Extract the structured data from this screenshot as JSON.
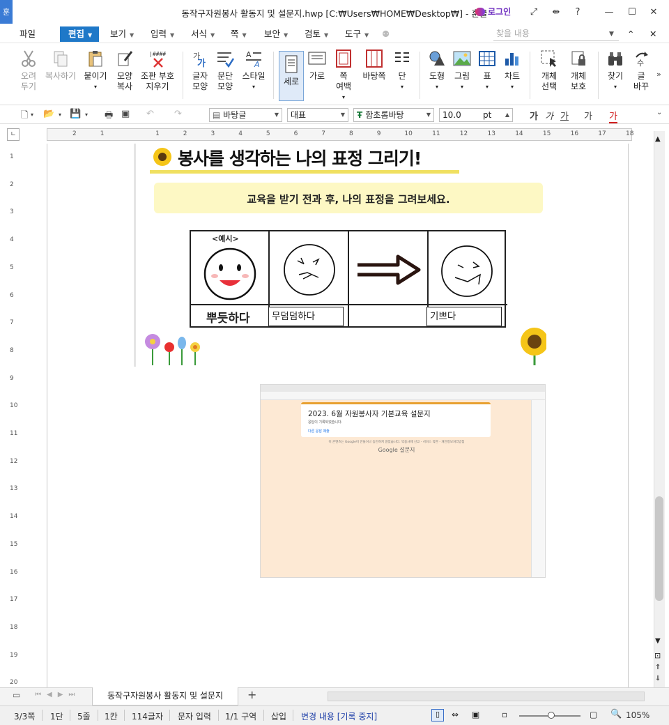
{
  "app": {
    "logo": "훈",
    "title": "동작구자원봉사 활동지 및 설문지.hwp [C:₩Users₩HOME₩Desktop₩] - 훈글",
    "login": "로그인"
  },
  "menu": {
    "file": "파일",
    "edit": "편집",
    "view": "보기",
    "input": "입력",
    "format": "서식",
    "page": "쪽",
    "security": "보안",
    "review": "검토",
    "tools": "도구",
    "search_placeholder": "찾을 내용"
  },
  "ribbon": {
    "cut": "오려\n두기",
    "copy": "복사하기",
    "paste": "붙이기",
    "format_copy": "모양\n복사",
    "clear_format": "조판 부호\n지우기",
    "char_shape": "글자\n모양",
    "para_shape": "문단\n모양",
    "style": "스타일",
    "vertical": "세로",
    "horizontal": "가로",
    "page_margin": "쪽\n여백",
    "background": "바탕쪽",
    "columns": "단",
    "shape": "도형",
    "picture": "그림",
    "table": "표",
    "chart": "차트",
    "obj_select": "개체\n선택",
    "obj_protect": "개체\n보호",
    "find": "찾기",
    "replace": "글\n바꾸"
  },
  "format_bar": {
    "style": "바탕글",
    "lang": "대표",
    "font": "함초롬바탕",
    "size": "10.0",
    "unit": "pt",
    "bold": "가",
    "italic": "가",
    "underline": "가"
  },
  "document": {
    "activity_title": "봉사를 생각하는 나의 표정 그리기!",
    "activity_subtitle": "교육을 받기 전과 후, 나의 표정을 그려보세요.",
    "example_label": "<예시>",
    "proud_label": "뿌듯하다",
    "before_label": "무덤덤하다",
    "after_label": "기쁘다",
    "form_title": "2023. 6월 자원봉사자 기본교육 설문지",
    "form_note": "응답이 기록되었습니다.",
    "form_link": "다른 응답 제출",
    "form_footer": "이 콘텐츠는 Google이 만들거나 승인하지 않았습니다. 악용사례 신고 - 서비스 약관 - 개인정보처리방침",
    "google_forms": "Google 설문지"
  },
  "tabs": {
    "doc_tab": "동작구자원봉사 활동지 및 설문지"
  },
  "status": {
    "page": "3/3쪽",
    "col": "1단",
    "line": "5줄",
    "cell": "1칸",
    "chars": "114글자",
    "mode": "문자 입력",
    "section": "1/1 구역",
    "insert": "삽입",
    "track": "변경 내용 [기록 중지]",
    "zoom": "105%"
  },
  "colors": {
    "accent": "#1e78c8",
    "login": "#7030c0",
    "track": "#1e3fa8"
  }
}
